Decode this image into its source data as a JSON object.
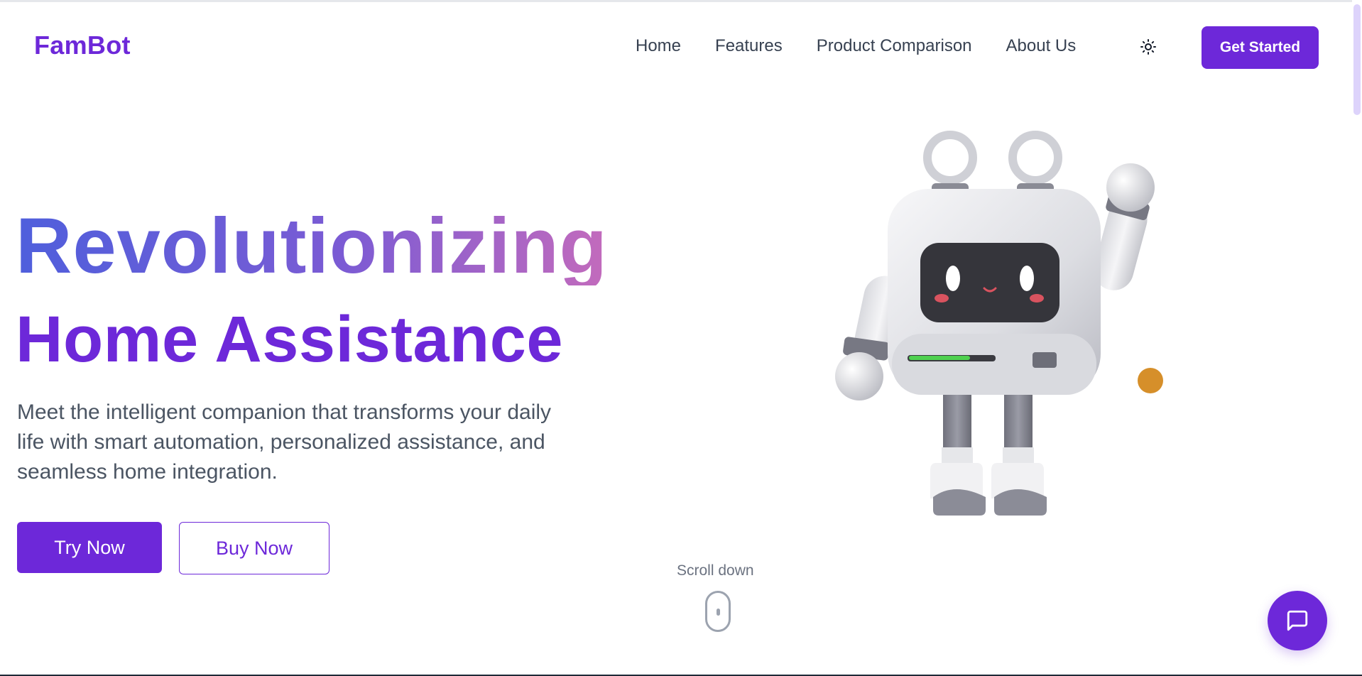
{
  "header": {
    "logo": "FamBot",
    "nav": [
      {
        "label": "Home"
      },
      {
        "label": "Features"
      },
      {
        "label": "Product Comparison"
      },
      {
        "label": "About Us"
      }
    ],
    "theme_toggle_icon": "sun-icon",
    "cta_label": "Get Started"
  },
  "hero": {
    "title_line1": "Revolutionizing",
    "title_line2": "Home Assistance",
    "description": "Meet the intelligent companion that transforms your daily life with smart automation, personalized assistance, and seamless home integration.",
    "primary_button": "Try Now",
    "secondary_button": "Buy Now",
    "image_icon": "robot-mascot-icon"
  },
  "scroll_hint": {
    "label": "Scroll down",
    "icon": "mouse-icon"
  },
  "chat": {
    "icon": "chat-bubble-icon"
  },
  "colors": {
    "brand": "#6d28d9",
    "gradient_start": "#4f5fdc",
    "gradient_end": "#c36bbc",
    "text_muted": "#4b5563",
    "accent_dot": "#d68f2a"
  }
}
